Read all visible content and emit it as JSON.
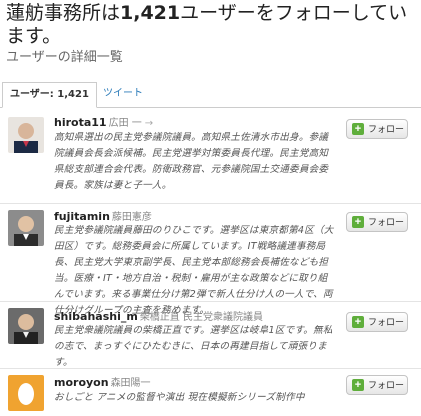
{
  "header": {
    "title_pre": "蓮舫事務所は",
    "title_count": "1,421",
    "title_post": "ユーザーをフォローしています。",
    "subtitle": "ユーザーの詳細一覧"
  },
  "tabs": [
    {
      "label": "ユーザー: 1,421"
    },
    {
      "label": "ツイート"
    }
  ],
  "follow_label": "フォロー",
  "users": [
    {
      "screen_name": "hirota11",
      "full_name": "広田 一",
      "bio": "高知県選出の民主党参議院議員。高知県土佐清水市出身。参議院議員会長会派候補。民主党選挙対策委員長代理。民主党高知県総支部連合会代表。防衛政務官、元参議院国土交通委員会委員長。家族は妻と子一人。"
    },
    {
      "screen_name": "fujitamin",
      "full_name": "藤田憲彦",
      "bio": "民主党参議院議員藤田のりひこです。選挙区は東京都第4区（大田区）です。総務委員会に所属しています。IT戦略議連事務局長、民主党大学東京副学長、民主党本部総務会長補佐なども担当。医療・IT・地方自治・税制・雇用が主な政策などに取り組んでいます。来る事業仕分け第2弾で新人仕分け人の一人で、両仕分けグループの主査を務めます。"
    },
    {
      "screen_name": "shibahashi_m",
      "full_name": "柴橋正直 民主党衆議院議員",
      "bio": "民主党衆議院議員の柴橋正直です。選挙区は岐阜1区です。無私の志で、まっすぐにひたむきに、日本の再建目指して頑張ります。"
    },
    {
      "screen_name": "moroyon",
      "full_name": "森田陽一",
      "bio": "おしごと アニメの監督や演出 現在模擬新シリーズ制作中"
    }
  ]
}
